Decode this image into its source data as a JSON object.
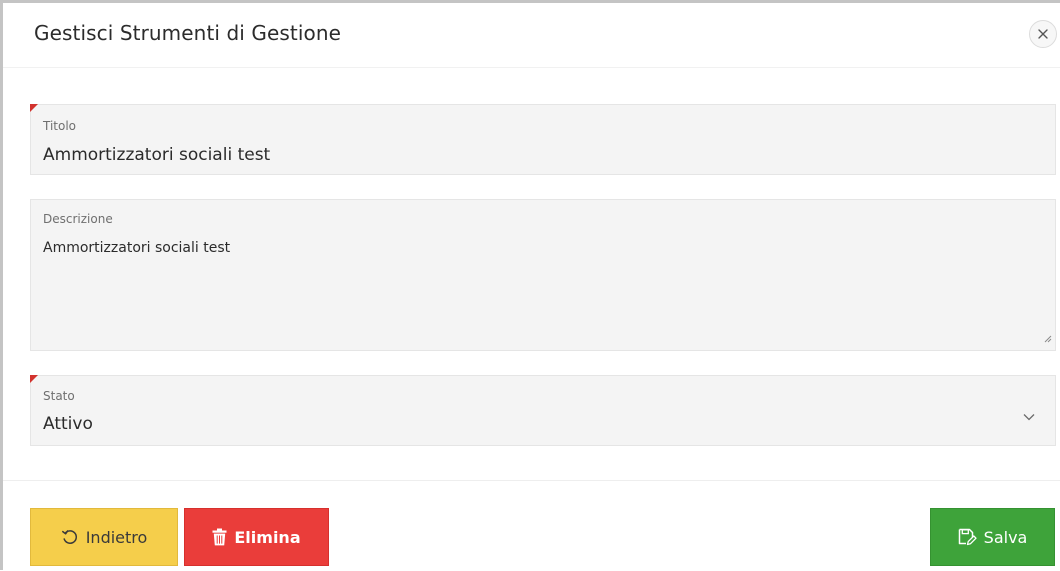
{
  "dialog": {
    "title": "Gestisci Strumenti di Gestione",
    "close_icon": "close-icon"
  },
  "form": {
    "titolo": {
      "label": "Titolo",
      "value": "Ammortizzatori sociali test",
      "required": true
    },
    "descrizione": {
      "label": "Descrizione",
      "value": "Ammortizzatori sociali test"
    },
    "stato": {
      "label": "Stato",
      "value": "Attivo",
      "required": true,
      "icon": "chevron-down-icon"
    }
  },
  "footer": {
    "back_label": "Indietro",
    "delete_label": "Elimina",
    "save_label": "Salva"
  },
  "colors": {
    "back_button": "#f5ce4b",
    "delete_button": "#ea3d3a",
    "save_button": "#3ea33a",
    "required_marker": "#d2322d"
  }
}
